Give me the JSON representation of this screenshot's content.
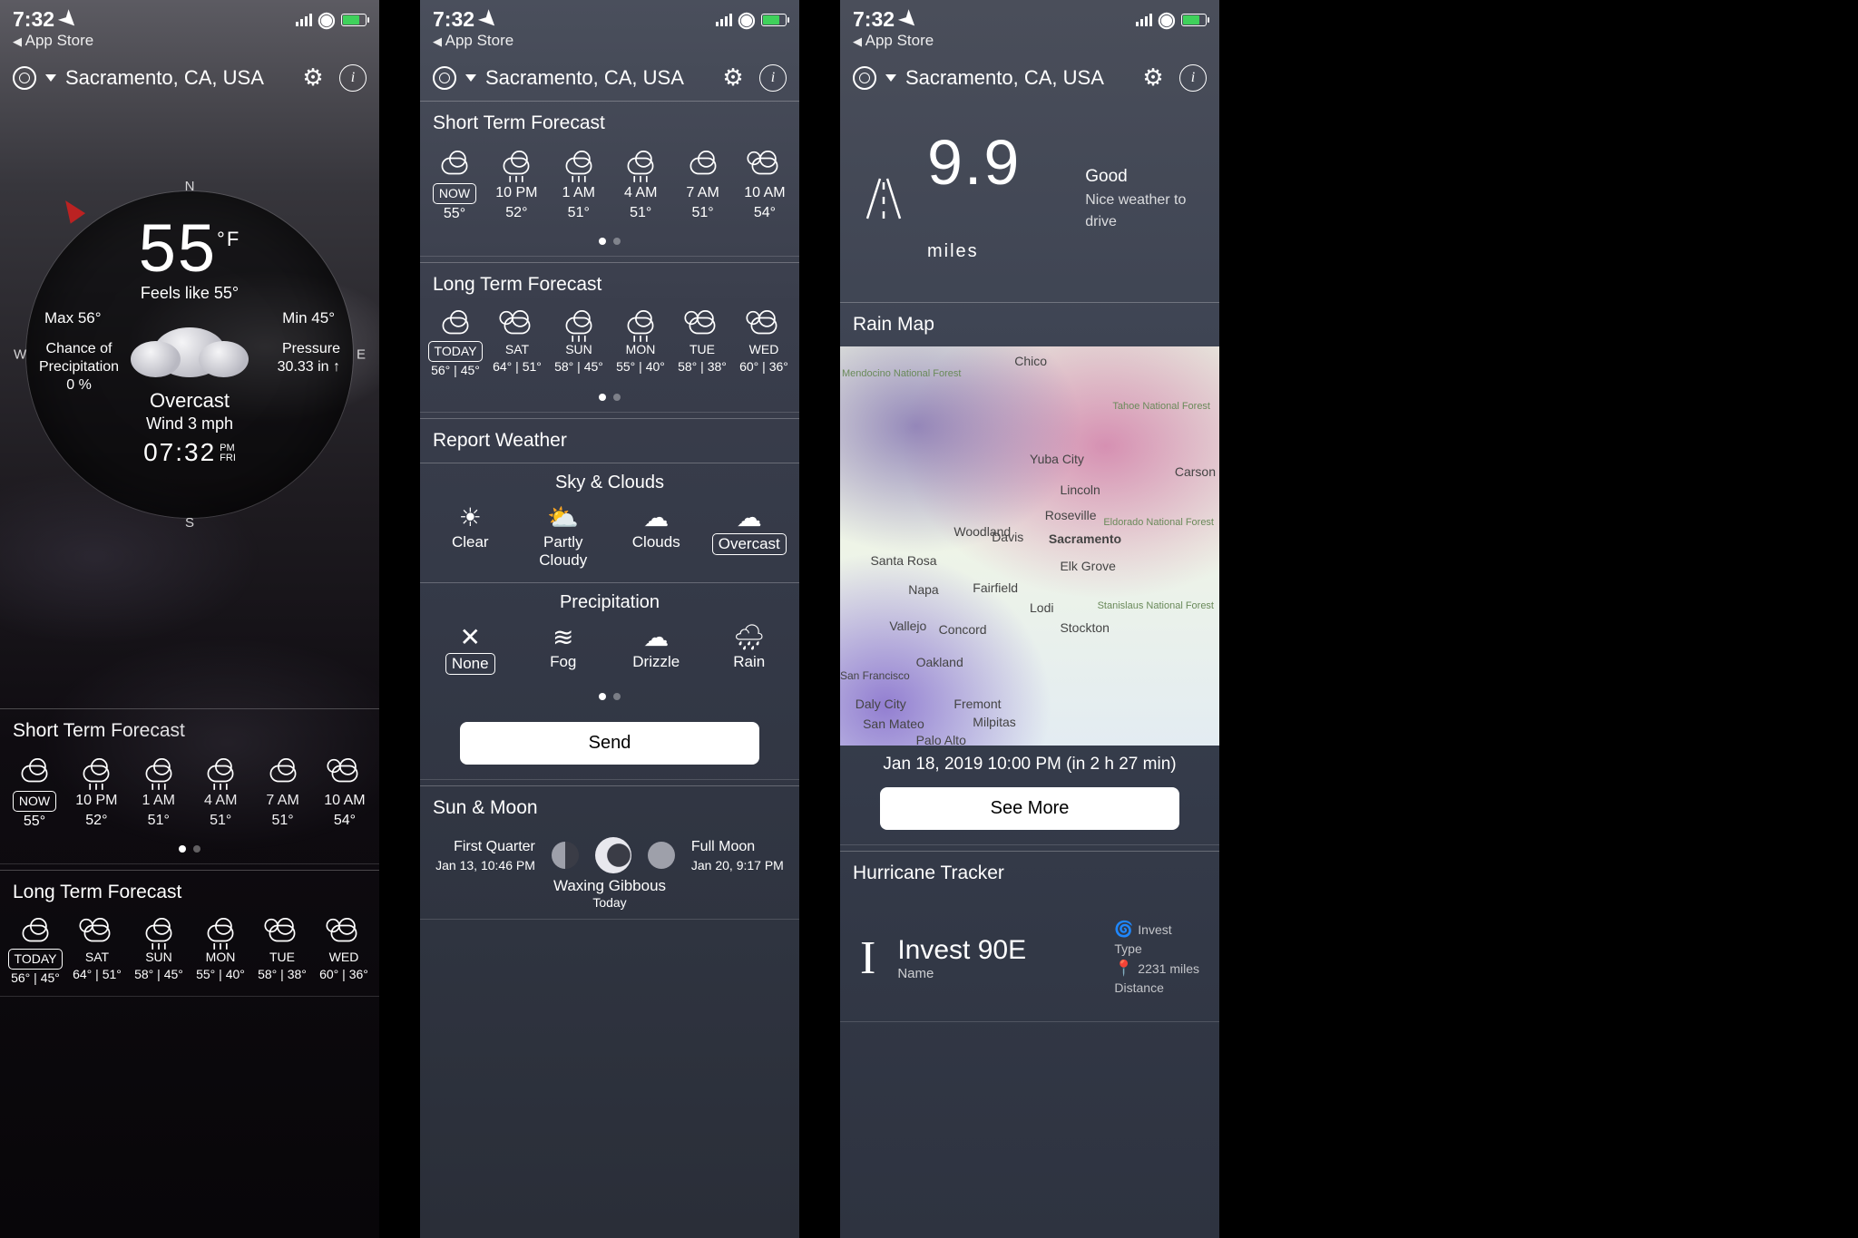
{
  "status": {
    "time": "7:32",
    "back": "App Store"
  },
  "header": {
    "location": "Sacramento, CA, USA"
  },
  "dial": {
    "temp": "55",
    "unit": "°F",
    "feels": "Feels like 55°",
    "max": "Max 56°",
    "min": "Min 45°",
    "precip_lbl": "Chance of\nPrecipitation",
    "precip_val": "0 %",
    "press_lbl": "Pressure",
    "press_val": "30.33 in ↑",
    "cond": "Overcast",
    "wind": "Wind 3 mph",
    "clock": "07:32",
    "clock_ampm": "PM",
    "clock_day": "FRI"
  },
  "short": {
    "title": "Short Term Forecast",
    "items": [
      {
        "t": "NOW",
        "v": "55°",
        "ic": "cloud"
      },
      {
        "t": "10 PM",
        "v": "52°",
        "ic": "rain"
      },
      {
        "t": "1 AM",
        "v": "51°",
        "ic": "rain"
      },
      {
        "t": "4 AM",
        "v": "51°",
        "ic": "rain"
      },
      {
        "t": "7 AM",
        "v": "51°",
        "ic": "cloud"
      },
      {
        "t": "10 AM",
        "v": "54°",
        "ic": "part"
      }
    ]
  },
  "long": {
    "title": "Long Term Forecast",
    "items": [
      {
        "t": "TODAY",
        "v": "56°  | 45°",
        "ic": "cloud"
      },
      {
        "t": "SAT",
        "v": "64°  | 51°",
        "ic": "part"
      },
      {
        "t": "SUN",
        "v": "58°  | 45°",
        "ic": "rain"
      },
      {
        "t": "MON",
        "v": "55°  | 40°",
        "ic": "rain"
      },
      {
        "t": "TUE",
        "v": "58°  | 38°",
        "ic": "part"
      },
      {
        "t": "WED",
        "v": "60°  | 36°",
        "ic": "part"
      }
    ]
  },
  "report": {
    "title": "Report Weather",
    "sky_title": "Sky & Clouds",
    "sky": [
      "Clear",
      "Partly Cloudy",
      "Clouds",
      "Overcast"
    ],
    "sky_sel": "Overcast",
    "precip_title": "Precipitation",
    "precip": [
      "None",
      "Fog",
      "Drizzle",
      "Rain"
    ],
    "precip_sel": "None",
    "send": "Send"
  },
  "sunmoon": {
    "title": "Sun & Moon",
    "first_lbl": "First Quarter",
    "first_date": "Jan 13, 10:46 PM",
    "full_lbl": "Full Moon",
    "full_date": "Jan 20, 9:17 PM",
    "cur_lbl": "Waxing Gibbous",
    "cur_day": "Today"
  },
  "drive": {
    "value": "9.9",
    "unit": "miles",
    "quality": "Good",
    "sub": "Nice weather to drive"
  },
  "rainmap": {
    "title": "Rain Map",
    "cities": [
      "Chico",
      "Yuba City",
      "Lincoln",
      "Roseville",
      "Sacramento",
      "Elk Grove",
      "Woodland",
      "Davis",
      "Santa Rosa",
      "Fairfield",
      "Napa",
      "Lodi",
      "Vallejo",
      "Concord",
      "Stockton",
      "Oakland",
      "San Francisco",
      "Daly City",
      "Fremont",
      "San Mateo",
      "Milpitas",
      "Palo Alto",
      "Carson"
    ],
    "time": "Jan 18, 2019 10:00 PM (in 2 h 27 min)",
    "seemore": "See More",
    "labels": [
      "Mendocino National Forest",
      "Tahoe National Forest",
      "Eldorado National Forest",
      "Stanislaus National Forest"
    ]
  },
  "hurricane": {
    "title": "Hurricane Tracker",
    "name": "Invest 90E",
    "name_lbl": "Name",
    "type": "Invest",
    "type_lbl": "Type",
    "dist": "2231 miles",
    "dist_lbl": "Distance"
  }
}
